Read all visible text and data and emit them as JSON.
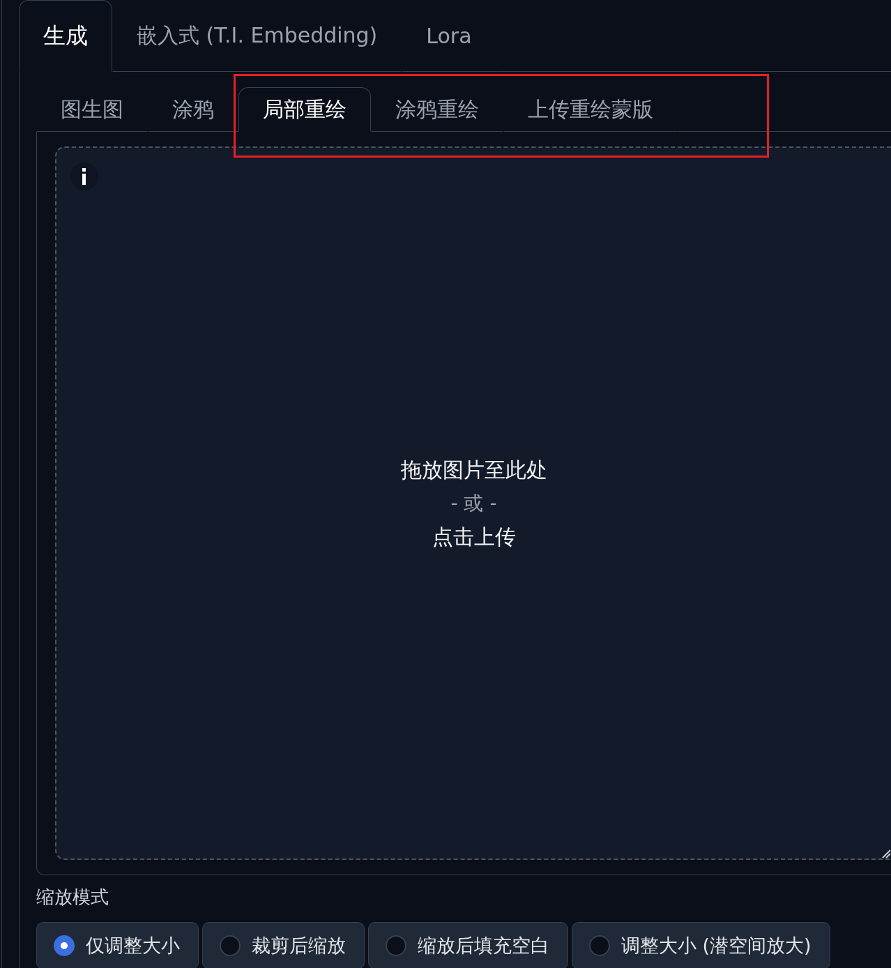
{
  "main_tabs": [
    {
      "label": "生成",
      "selected": true
    },
    {
      "label": "嵌入式 (T.I. Embedding)",
      "selected": false
    },
    {
      "label": "Lora",
      "selected": false
    }
  ],
  "sub_tabs": [
    {
      "label": "图生图",
      "selected": false
    },
    {
      "label": "涂鸦",
      "selected": false
    },
    {
      "label": "局部重绘",
      "selected": true
    },
    {
      "label": "涂鸦重绘",
      "selected": false
    },
    {
      "label": "上传重绘蒙版",
      "selected": false
    }
  ],
  "highlight": {
    "color": "#e3202a"
  },
  "upload": {
    "title": "拖放图片至此处",
    "separator": "- 或 -",
    "action": "点击上传"
  },
  "resize_mode": {
    "label": "缩放模式",
    "options": [
      {
        "label": "仅调整大小",
        "selected": true
      },
      {
        "label": "裁剪后缩放",
        "selected": false
      },
      {
        "label": "缩放后填充空白",
        "selected": false
      },
      {
        "label": "调整大小 (潜空间放大)",
        "selected": false
      }
    ]
  }
}
